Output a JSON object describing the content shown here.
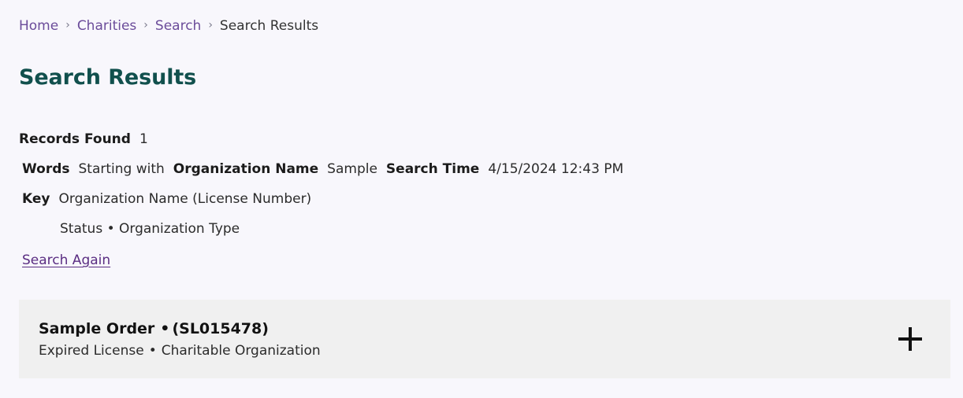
{
  "breadcrumb": {
    "separator": "›",
    "items": [
      {
        "label": "Home",
        "current": false
      },
      {
        "label": "Charities",
        "current": false
      },
      {
        "label": "Search",
        "current": false
      },
      {
        "label": "Search Results",
        "current": true
      }
    ]
  },
  "page_title": "Search Results",
  "summary": {
    "records_found_label": "Records Found",
    "records_found_value": "1",
    "words_label": "Words",
    "words_match_type": "Starting with",
    "field_label": "Organization Name",
    "field_value": "Sample",
    "search_time_label": "Search Time",
    "search_time_value": "4/15/2024 12:43 PM",
    "key_label": "Key",
    "key_line_1": "Organization Name (License Number)",
    "key_line_2": "Status • Organization Type"
  },
  "search_again_link": "Search Again",
  "results": [
    {
      "name": "Sample Order",
      "separator": "•",
      "license_number": "(SL015478)",
      "status": "Expired License",
      "sub_separator": "•",
      "organization_type": "Charitable Organization",
      "expand_icon": "plus-icon"
    }
  ],
  "colors": {
    "page_background": "#f8f7fc",
    "heading_teal": "#11504d",
    "link_purple": "#5a2d82",
    "breadcrumb_purple": "#6b4c9a",
    "card_background": "#f0f0f0",
    "body_text": "#1b1b1b"
  }
}
